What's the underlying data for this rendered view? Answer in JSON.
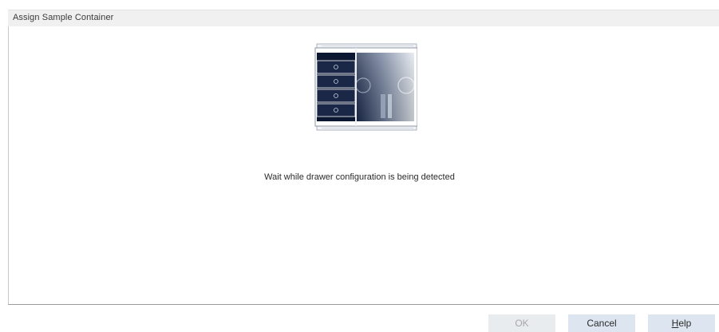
{
  "dialog": {
    "title": "Assign Sample Container",
    "status_message": "Wait while drawer configuration is being detected"
  },
  "buttons": {
    "ok_label": "OK",
    "cancel_label": "Cancel",
    "help_mnemonic": "H",
    "help_rest": "elp"
  },
  "ok_enabled": false,
  "illustration": {
    "icon": "sample-drawer-illustration"
  },
  "colors": {
    "title_bar": "#f0f0f0",
    "button_bg": "#dde6f0",
    "button_disabled_bg": "#e9ecef",
    "drawer_dark": "#0d1a35"
  }
}
